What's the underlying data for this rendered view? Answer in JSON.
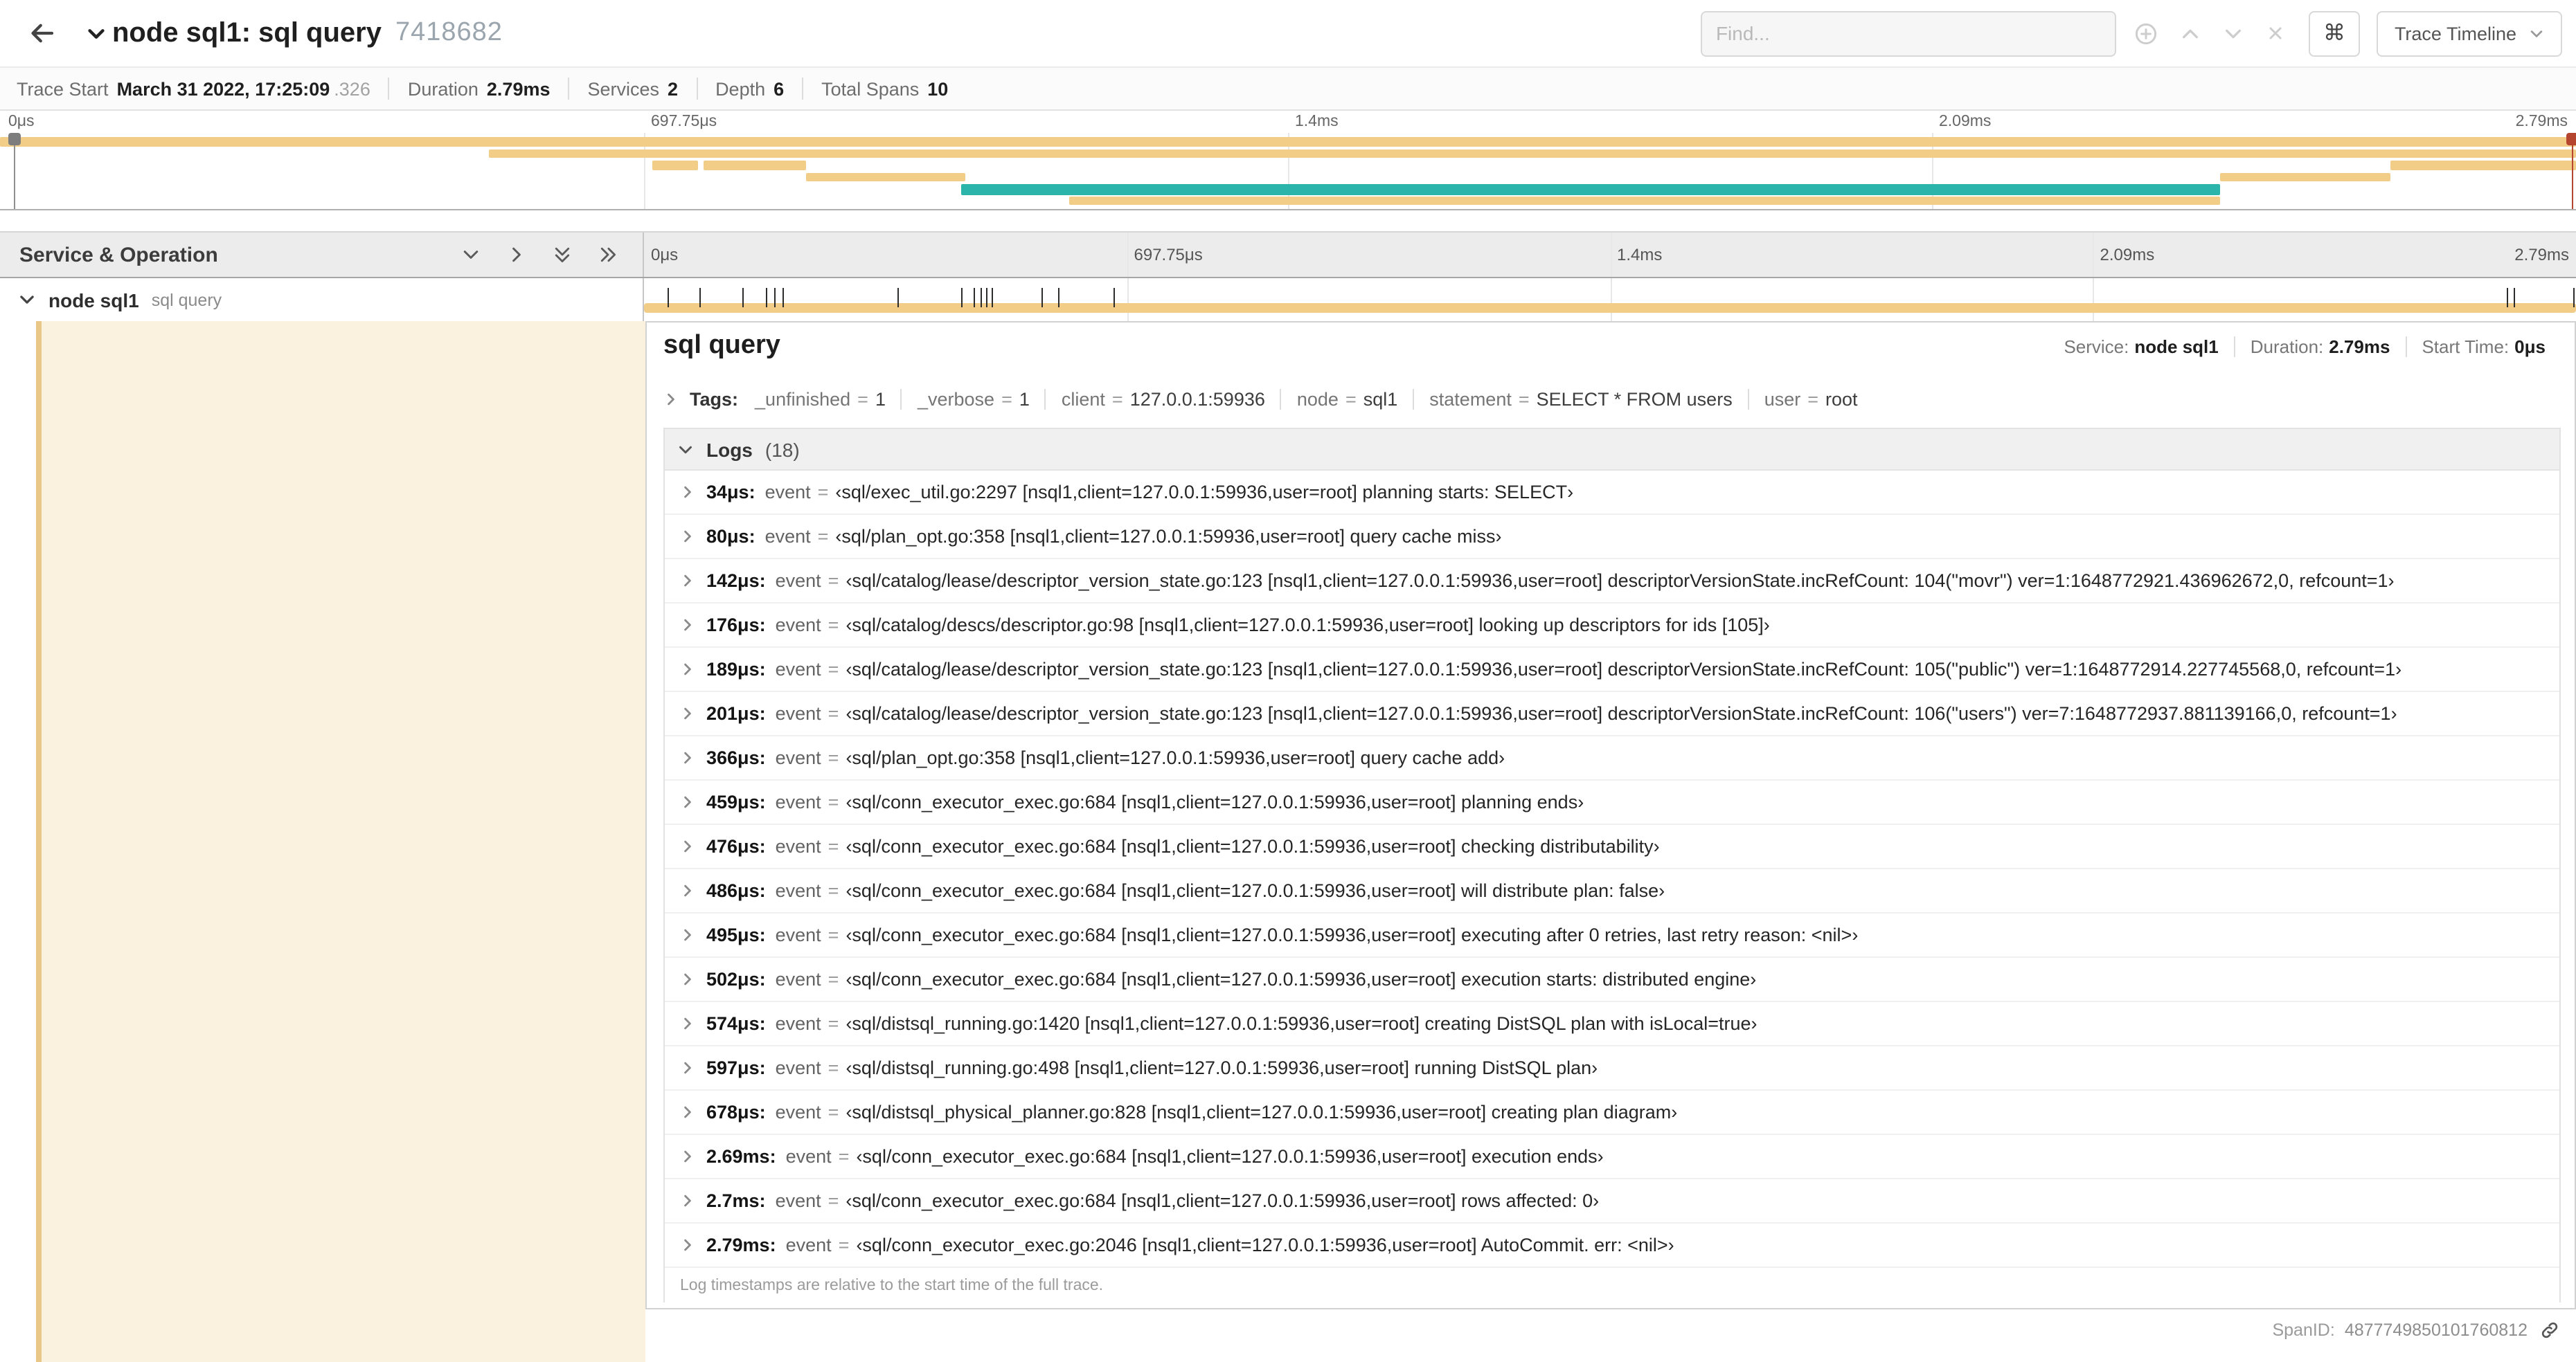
{
  "header": {
    "title": "node sql1: sql query",
    "trace_id": "7418682",
    "find_placeholder": "Find...",
    "command_key": "⌘",
    "view_button": "Trace Timeline"
  },
  "summary": {
    "trace_start": {
      "label": "Trace Start",
      "value": "March 31 2022, 17:25:09",
      "fraction": ".326"
    },
    "duration": {
      "label": "Duration",
      "value": "2.79ms"
    },
    "services": {
      "label": "Services",
      "value": "2"
    },
    "depth": {
      "label": "Depth",
      "value": "6"
    },
    "total_spans": {
      "label": "Total Spans",
      "value": "10"
    }
  },
  "colors": {
    "span_tan": "#f1cd87",
    "span_teal": "#2bb5aa"
  },
  "minimap": {
    "bars": [
      {
        "x": 0,
        "w": 100,
        "row": 0,
        "color": "#f1cd87"
      },
      {
        "x": 19,
        "w": 81,
        "row": 1,
        "color": "#f1cd87"
      },
      {
        "x": 25.3,
        "w": 1.8,
        "row": 2,
        "color": "#f1cd87"
      },
      {
        "x": 27.3,
        "w": 4.0,
        "row": 2,
        "color": "#f1cd87"
      },
      {
        "x": 31.3,
        "w": 6.2,
        "row": 3,
        "color": "#f1cd87"
      },
      {
        "x": 37.3,
        "w": 48.9,
        "row": 4,
        "color": "#2bb5aa",
        "h": 8
      },
      {
        "x": 41.5,
        "w": 44.7,
        "row": 5,
        "color": "#f1cd87"
      },
      {
        "x": 86.2,
        "w": 6.6,
        "row": 3,
        "color": "#f1cd87"
      },
      {
        "x": 92.8,
        "w": 7.2,
        "row": 2,
        "color": "#f1cd87"
      }
    ]
  },
  "timeline": {
    "ticks": [
      "0μs",
      "697.75μs",
      "1.4ms",
      "2.09ms",
      "2.79ms"
    ],
    "left_header": "Service & Operation",
    "row": {
      "service": "node sql1",
      "operation": "sql query",
      "tick_positions_pct": [
        1.22,
        2.87,
        5.09,
        6.31,
        6.77,
        7.2,
        13.12,
        16.45,
        17.06,
        17.42,
        17.74,
        17.99,
        20.57,
        21.4,
        24.3,
        96.42,
        96.77,
        99.85
      ]
    }
  },
  "detail": {
    "title": "sql query",
    "eq": "=",
    "info": {
      "service_label": "Service:",
      "service": "node sql1",
      "duration_label": "Duration:",
      "duration": "2.79ms",
      "start_label": "Start Time:",
      "start": "0μs"
    },
    "tags_label": "Tags:",
    "tags": [
      {
        "k": "_unfinished",
        "v": "1"
      },
      {
        "k": "_verbose",
        "v": "1"
      },
      {
        "k": "client",
        "v": "127.0.0.1:59936"
      },
      {
        "k": "node",
        "v": "sql1"
      },
      {
        "k": "statement",
        "v": "SELECT * FROM users"
      },
      {
        "k": "user",
        "v": "root"
      }
    ],
    "logs_title": "Logs",
    "logs_count": "(18)",
    "logs": [
      {
        "t": "34μs:",
        "k": "event",
        "v": "‹sql/exec_util.go:2297 [nsql1,client=127.0.0.1:59936,user=root] planning starts: SELECT›"
      },
      {
        "t": "80μs:",
        "k": "event",
        "v": "‹sql/plan_opt.go:358 [nsql1,client=127.0.0.1:59936,user=root] query cache miss›"
      },
      {
        "t": "142μs:",
        "k": "event",
        "v": "‹sql/catalog/lease/descriptor_version_state.go:123 [nsql1,client=127.0.0.1:59936,user=root] descriptorVersionState.incRefCount: 104(\"movr\") ver=1:1648772921.436962672,0, refcount=1›"
      },
      {
        "t": "176μs:",
        "k": "event",
        "v": "‹sql/catalog/descs/descriptor.go:98 [nsql1,client=127.0.0.1:59936,user=root] looking up descriptors for ids [105]›"
      },
      {
        "t": "189μs:",
        "k": "event",
        "v": "‹sql/catalog/lease/descriptor_version_state.go:123 [nsql1,client=127.0.0.1:59936,user=root] descriptorVersionState.incRefCount: 105(\"public\") ver=1:1648772914.227745568,0, refcount=1›"
      },
      {
        "t": "201μs:",
        "k": "event",
        "v": "‹sql/catalog/lease/descriptor_version_state.go:123 [nsql1,client=127.0.0.1:59936,user=root] descriptorVersionState.incRefCount: 106(\"users\") ver=7:1648772937.881139166,0, refcount=1›"
      },
      {
        "t": "366μs:",
        "k": "event",
        "v": "‹sql/plan_opt.go:358 [nsql1,client=127.0.0.1:59936,user=root] query cache add›"
      },
      {
        "t": "459μs:",
        "k": "event",
        "v": "‹sql/conn_executor_exec.go:684 [nsql1,client=127.0.0.1:59936,user=root] planning ends›"
      },
      {
        "t": "476μs:",
        "k": "event",
        "v": "‹sql/conn_executor_exec.go:684 [nsql1,client=127.0.0.1:59936,user=root] checking distributability›"
      },
      {
        "t": "486μs:",
        "k": "event",
        "v": "‹sql/conn_executor_exec.go:684 [nsql1,client=127.0.0.1:59936,user=root] will distribute plan: false›"
      },
      {
        "t": "495μs:",
        "k": "event",
        "v": "‹sql/conn_executor_exec.go:684 [nsql1,client=127.0.0.1:59936,user=root] executing after 0 retries, last retry reason: <nil>›"
      },
      {
        "t": "502μs:",
        "k": "event",
        "v": "‹sql/conn_executor_exec.go:684 [nsql1,client=127.0.0.1:59936,user=root] execution starts: distributed engine›"
      },
      {
        "t": "574μs:",
        "k": "event",
        "v": "‹sql/distsql_running.go:1420 [nsql1,client=127.0.0.1:59936,user=root] creating DistSQL plan with isLocal=true›"
      },
      {
        "t": "597μs:",
        "k": "event",
        "v": "‹sql/distsql_running.go:498 [nsql1,client=127.0.0.1:59936,user=root] running DistSQL plan›"
      },
      {
        "t": "678μs:",
        "k": "event",
        "v": "‹sql/distsql_physical_planner.go:828 [nsql1,client=127.0.0.1:59936,user=root] creating plan diagram›"
      },
      {
        "t": "2.69ms:",
        "k": "event",
        "v": "‹sql/conn_executor_exec.go:684 [nsql1,client=127.0.0.1:59936,user=root] execution ends›"
      },
      {
        "t": "2.7ms:",
        "k": "event",
        "v": "‹sql/conn_executor_exec.go:684 [nsql1,client=127.0.0.1:59936,user=root] rows affected: 0›"
      },
      {
        "t": "2.79ms:",
        "k": "event",
        "v": "‹sql/conn_executor_exec.go:2046 [nsql1,client=127.0.0.1:59936,user=root] AutoCommit. err: <nil>›"
      }
    ],
    "logs_note": "Log timestamps are relative to the start time of the full trace.",
    "span_id_label": "SpanID:",
    "span_id": "4877749850101760812"
  }
}
